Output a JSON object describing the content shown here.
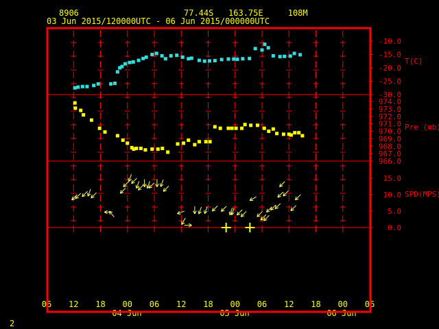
{
  "header": {
    "station_id": "8906",
    "location": "77.44S   163.75E     108M",
    "time_range": "03 Jun 2015/120000UTC - 06 Jun 2015/000000UTC"
  },
  "page_number": "2",
  "colors": {
    "background": "#000000",
    "frame": "#ff0000",
    "header_text": "#ffff00",
    "temperature": "#33dddd",
    "pressure": "#ffff00",
    "wind": "#ffff66",
    "wind_cross": "#ffff00"
  },
  "chart_data": [
    {
      "panel": "temperature",
      "type": "scatter",
      "ylabel": "T(C)",
      "ylim": [
        -30,
        -10
      ],
      "yticks": [
        "-10.0",
        "-15.0",
        "-20.0",
        "-25.0",
        "-30.0"
      ],
      "x_hours": [
        0.3,
        1.0,
        2.0,
        3.0,
        4.5,
        5.5,
        8.3,
        9.2,
        9.8,
        10.3,
        10.8,
        11.5,
        12.5,
        13.3,
        14.5,
        15.5,
        16.2,
        17.5,
        18.5,
        19.7,
        20.5,
        21.7,
        23.0,
        24.3,
        25.6,
        26.3,
        28.0,
        29.2,
        30.3,
        31.5,
        33.0,
        34.5,
        35.7,
        36.5,
        37.7,
        39.2,
        40.5,
        42.0,
        42.6,
        43.4,
        44.5,
        46.0,
        47.0,
        48.3,
        49.2,
        50.5
      ],
      "values": [
        -27.5,
        -27.2,
        -27.0,
        -27.0,
        -26.6,
        -26.0,
        -26.0,
        -25.8,
        -21.5,
        -20.0,
        -19.5,
        -18.5,
        -18.0,
        -17.8,
        -17.2,
        -16.5,
        -16.0,
        -15.0,
        -14.6,
        -15.5,
        -16.6,
        -15.5,
        -15.3,
        -16.0,
        -16.6,
        -16.4,
        -17.2,
        -17.5,
        -17.4,
        -17.3,
        -16.9,
        -16.7,
        -16.7,
        -16.8,
        -16.6,
        -16.5,
        -12.8,
        -13.3,
        -11.2,
        -12.5,
        -15.5,
        -15.8,
        -15.7,
        -15.6,
        -14.6,
        -15.1
      ]
    },
    {
      "panel": "pressure",
      "type": "scatter",
      "ylabel": "Pre (mb)",
      "ylim": [
        966,
        974
      ],
      "yticks": [
        "974.0",
        "973.0",
        "972.0",
        "971.0",
        "970.0",
        "969.0",
        "968.0",
        "967.0",
        "966.0"
      ],
      "x_hours": [
        0.3,
        0.4,
        1.6,
        2.2,
        4.0,
        5.8,
        7.0,
        9.8,
        11.0,
        12.0,
        13.0,
        13.4,
        14.0,
        15.0,
        16.0,
        17.5,
        18.8,
        19.8,
        21.0,
        23.2,
        24.5,
        25.6,
        27.0,
        28.0,
        29.5,
        30.4,
        31.5,
        32.7,
        34.5,
        35.3,
        36.2,
        37.5,
        38.2,
        39.5,
        41.0,
        42.5,
        43.5,
        44.5,
        45.3,
        46.8,
        48.0,
        48.5,
        49.3,
        50.2,
        51.0
      ],
      "values": [
        973.8,
        973.1,
        972.8,
        972.2,
        971.5,
        970.4,
        969.9,
        969.4,
        968.8,
        968.4,
        967.8,
        967.6,
        967.7,
        967.7,
        967.5,
        967.6,
        967.6,
        967.7,
        967.2,
        968.3,
        968.4,
        968.8,
        968.2,
        968.6,
        968.6,
        968.6,
        970.6,
        970.4,
        970.4,
        970.4,
        970.4,
        970.4,
        970.9,
        970.8,
        970.8,
        970.4,
        970.0,
        970.3,
        969.7,
        969.6,
        969.6,
        969.5,
        969.8,
        969.8,
        969.4
      ]
    },
    {
      "panel": "wind",
      "type": "scatter",
      "ylabel": "SPD(MPS)",
      "ylim": [
        0,
        15
      ],
      "yticks": [
        "15.0",
        "10.0",
        "5.0",
        "0.0"
      ],
      "x_hours": [
        0.2,
        1.0,
        2.5,
        3.5,
        4.5,
        7.7,
        8.5,
        11.0,
        11.7,
        12.6,
        13.5,
        14.3,
        15.0,
        15.8,
        16.7,
        17.4,
        18.6,
        19.7,
        20.6,
        23.9,
        24.5,
        25.5,
        27.0,
        28.2,
        29.5,
        31.5,
        33.5,
        35.1,
        35.5,
        37.0,
        37.9,
        40.0,
        41.5,
        42.3,
        43.0,
        43.6,
        44.5,
        45.5,
        46.1,
        46.5,
        47.3,
        49.0,
        50.0,
        39.3,
        34.0
      ],
      "values": [
        9.2,
        9.6,
        10.2,
        10.6,
        9.8,
        4.7,
        4.1,
        11.2,
        13.2,
        15.1,
        14.2,
        13.0,
        12.2,
        13.5,
        13.0,
        12.8,
        13.5,
        13.5,
        11.8,
        4.6,
        1.9,
        0.7,
        5.3,
        5.2,
        5.3,
        5.8,
        5.7,
        4.9,
        4.9,
        4.6,
        4.1,
        8.8,
        4.1,
        3.1,
        2.9,
        5.5,
        6.1,
        6.5,
        10.0,
        13.2,
        10.4,
        5.9,
        9.2,
        0.0,
        0.0
      ],
      "direction_deg": [
        225,
        225,
        225,
        200,
        225,
        270,
        320,
        225,
        225,
        200,
        225,
        200,
        225,
        180,
        200,
        225,
        180,
        200,
        225,
        250,
        210,
        90,
        180,
        200,
        200,
        225,
        225,
        200,
        200,
        225,
        225,
        240,
        225,
        225,
        225,
        225,
        225,
        225,
        225,
        225,
        225,
        225,
        225,
        0,
        0
      ]
    }
  ],
  "x_axis": {
    "tick_labels": [
      "06",
      "12",
      "18",
      "00",
      "06",
      "12",
      "18",
      "00",
      "06",
      "12",
      "18",
      "00",
      "06"
    ],
    "day_labels": [
      "04 Jun",
      "05 Jun",
      "06 Jun"
    ]
  }
}
